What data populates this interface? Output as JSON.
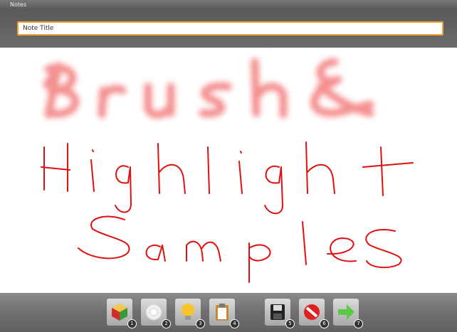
{
  "app": {
    "title": "Notes"
  },
  "note": {
    "title_placeholder": "Note Title",
    "title_value": ""
  },
  "toolbar": {
    "buttons": [
      {
        "name": "color-picker",
        "icon": "color-cube-icon",
        "badge": "1"
      },
      {
        "name": "stroke-picker",
        "icon": "brush-icon",
        "badge": "2"
      },
      {
        "name": "highlighter",
        "icon": "lightbulb-icon",
        "badge": "3"
      },
      {
        "name": "clipboard",
        "icon": "clipboard-icon",
        "badge": "4"
      },
      {
        "name": "save",
        "icon": "floppy-disk-icon",
        "badge": "5"
      },
      {
        "name": "cancel",
        "icon": "no-entry-icon",
        "badge": "6"
      },
      {
        "name": "next",
        "icon": "arrow-right-icon",
        "badge": "7"
      }
    ]
  },
  "colors": {
    "brush": "#f06060",
    "ink": "#e01010",
    "accent": "#f0a030"
  }
}
